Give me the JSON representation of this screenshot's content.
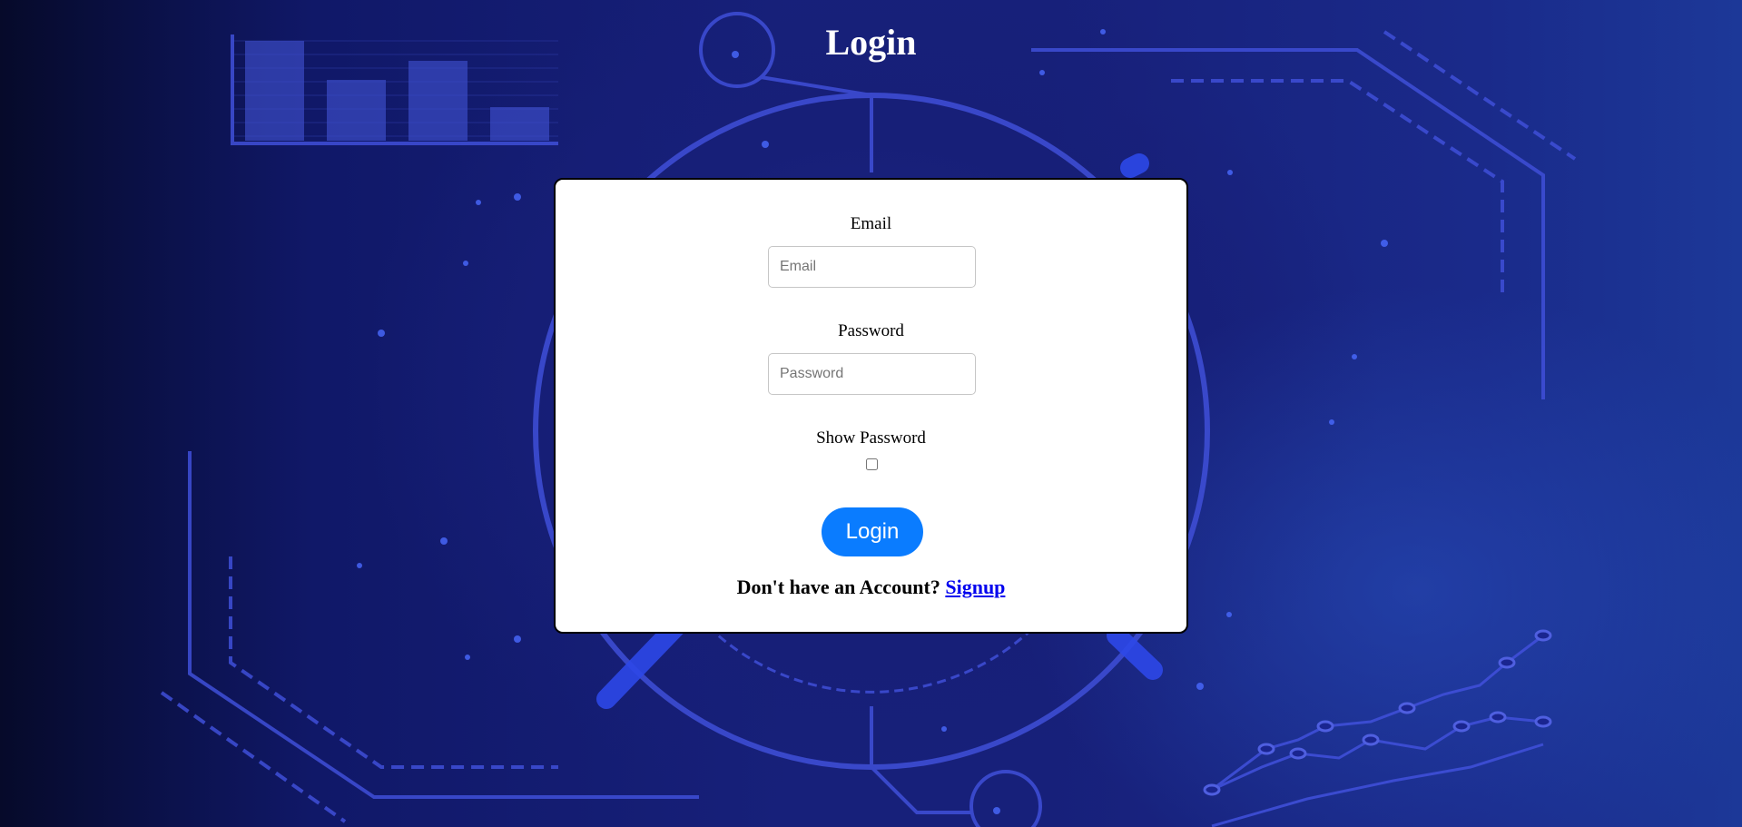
{
  "page": {
    "title": "Login"
  },
  "form": {
    "email": {
      "label": "Email",
      "placeholder": "Email",
      "value": ""
    },
    "password": {
      "label": "Password",
      "placeholder": "Password",
      "value": ""
    },
    "show_password": {
      "label": "Show Password",
      "checked": false
    },
    "login_button": "Login",
    "signup": {
      "prompt": "Don't have an Account?",
      "link_text": "Signup"
    }
  },
  "colors": {
    "background": "#17207a",
    "accent_line": "#3f4fd8",
    "button": "#0a7cff",
    "link": "#0000ee"
  }
}
